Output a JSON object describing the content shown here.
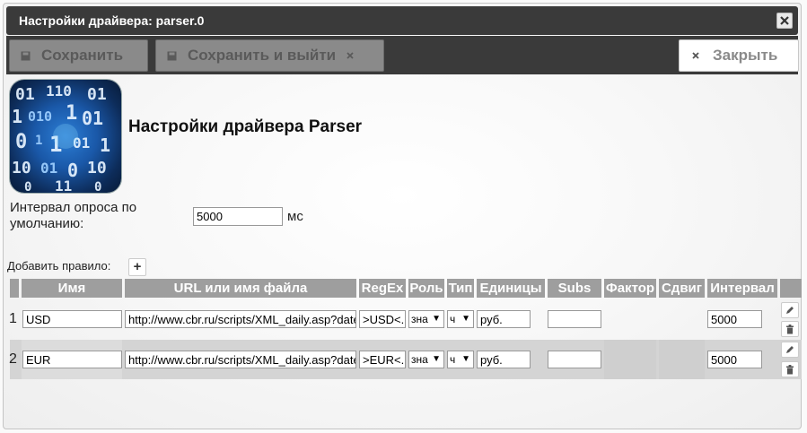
{
  "window": {
    "title": "Настройки драйвера: parser.0"
  },
  "toolbar": {
    "save_label": "Сохранить",
    "save_exit_label": "Сохранить и выйти",
    "close_label": "Закрыть"
  },
  "main": {
    "heading": "Настройки драйвера Parser",
    "interval_label": "Интервал опроса по умолчанию:",
    "interval_value": "5000",
    "interval_unit": "мс",
    "add_rule_label": "Добавить правило:",
    "add_rule_button": "+"
  },
  "table": {
    "headers": [
      "Имя",
      "URL или имя файла",
      "RegEx",
      "Роль",
      "Тип",
      "Единицы",
      "Subs",
      "Фактор",
      "Сдвиг",
      "Интервал",
      ""
    ],
    "rows": [
      {
        "num": "1",
        "name": "USD",
        "url": "http://www.cbr.ru/scripts/XML_daily.asp?date_req=",
        "regex": ">USD<.",
        "role": "зна",
        "type": "ч",
        "units": "руб.",
        "subs": "",
        "factor": "",
        "offset": "",
        "interval": "5000"
      },
      {
        "num": "2",
        "name": "EUR",
        "url": "http://www.cbr.ru/scripts/XML_daily.asp?date_req=",
        "regex": ">EUR<.",
        "role": "зна",
        "type": "ч",
        "units": "руб.",
        "subs": "",
        "factor": "",
        "offset": "",
        "interval": "5000"
      }
    ]
  },
  "icons": [
    "floppy-icon",
    "close-icon",
    "pencil-icon",
    "trash-icon",
    "plus-icon",
    "binary-logo"
  ],
  "colors": {
    "titlebar": "#3a3a3a",
    "header": "#9e9e9e",
    "row_alt": "#d4d4d4"
  }
}
